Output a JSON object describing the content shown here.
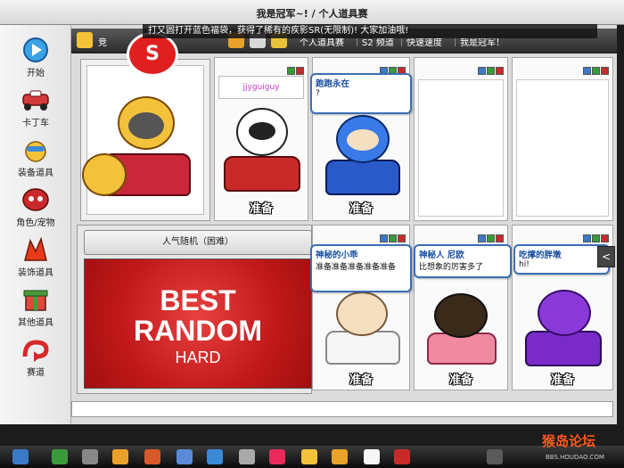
{
  "window": {
    "title": "我是冠军~! / 个人道具赛",
    "ticker": "打又圆打开蓝色福袋，获得了稀有的疾影SR(无限制)! 大家加油哦!"
  },
  "sidebar": {
    "items": [
      {
        "label": "开始",
        "icon": "play-arrow-icon",
        "color": "#3ba2e8"
      },
      {
        "label": "卡丁车",
        "icon": "kart-icon",
        "color": "#d23a3a"
      },
      {
        "label": "装备道具",
        "icon": "equipment-icon",
        "color": "#e8a22a"
      },
      {
        "label": "角色/宠物",
        "icon": "character-icon",
        "color": "#c8282a"
      },
      {
        "label": "装饰道具",
        "icon": "decoration-icon",
        "color": "#e83a1a"
      },
      {
        "label": "其他道具",
        "icon": "other-items-icon",
        "color": "#4a9a3a"
      },
      {
        "label": "赛道",
        "icon": "track-icon",
        "color": "#d8282a"
      }
    ]
  },
  "mode_bar": {
    "left_label": "竞",
    "items": [
      "个人道具赛",
      "S2 频道",
      "快速速度",
      "我是冠军！"
    ]
  },
  "slots": [
    {
      "player_name": "jjyguiguy",
      "status": "准备"
    },
    {
      "player_name": "跑跑永在",
      "chat": "?",
      "status": "准备"
    },
    {
      "player_name": "",
      "status": ""
    },
    {
      "player_name": "",
      "status": ""
    },
    {
      "player_name": "神秘的小乖",
      "chat": "准备准备准备准备准备",
      "status": "准备"
    },
    {
      "player_name": "神秘人 尼欧",
      "chat": "比想象的厉害多了",
      "status": "准备"
    },
    {
      "player_name": "吃撑的胖墩",
      "chat": "hi!",
      "status": "准备"
    }
  ],
  "host": {
    "level_badge": "S"
  },
  "room_mode": "人气随机（困难）",
  "track_card": {
    "line1": "BEST",
    "line2": "RANDOM",
    "line3": "HARD"
  },
  "scroll_arrow": "<",
  "watermark": {
    "text": "猴岛论坛",
    "sub": "BBS.HOUDAO.COM"
  },
  "colors": {
    "bubble_border": "#3c6fb4",
    "track_red": "#c01818",
    "ready_text": "#ffffff"
  }
}
